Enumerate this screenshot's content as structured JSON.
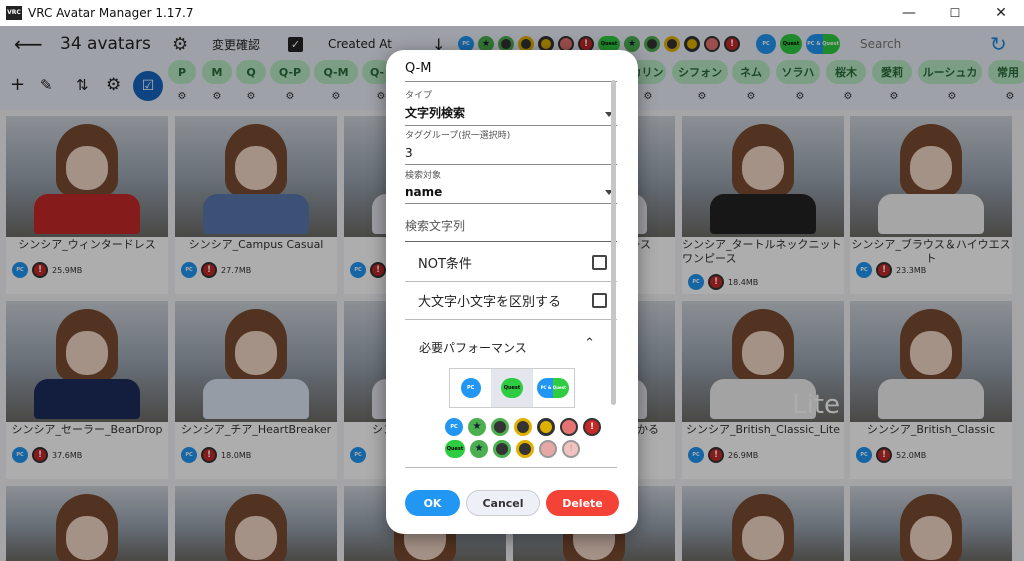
{
  "window": {
    "title": "VRC Avatar Manager 1.17.7",
    "minimize": "—",
    "maximize": "☐",
    "close": "✕"
  },
  "appbar": {
    "back_icon": "arrow-left-icon",
    "avatar_count": "34 avatars",
    "change_confirm": "変更確認",
    "sort_label": "Created At",
    "search_placeholder": "Search"
  },
  "chips": [
    "P",
    "M",
    "Q",
    "Q-P",
    "Q-M",
    "Q-",
    "カリン",
    "シフォン",
    "ネム",
    "ソラハ",
    "桜木",
    "愛莉",
    "ルーシュカ",
    "常用"
  ],
  "filter_badges": {
    "pc": "PC",
    "quest": "Quest",
    "pcq": "PC & Quest"
  },
  "cards": [
    {
      "name": "シンシア_ウィンタードレス",
      "size": "25.9MB"
    },
    {
      "name": "シンシア_Campus Casual",
      "size": "27.7MB"
    },
    {
      "name": "",
      "size": ""
    },
    {
      "name": "",
      "size": ""
    },
    {
      "name": "ース",
      "size": ""
    },
    {
      "name": "シンシア_タートルネックニットワンピース",
      "size": "18.4MB"
    },
    {
      "name": "シンシア_ブラウス＆ハイウエスト",
      "size": "23.3MB"
    },
    {
      "name": "シンシア_セーラー_BearDrop",
      "size": "37.6MB"
    },
    {
      "name": "シンシア_チア_HeartBreaker",
      "size": "18.0MB"
    },
    {
      "name": "シン",
      "size": ""
    },
    {
      "name": "",
      "size": ""
    },
    {
      "name": "じかる",
      "size": ""
    },
    {
      "name": "シンシア_British_Classic_Lite",
      "size": "26.9MB"
    },
    {
      "name": "シンシア_British_Classic",
      "size": "52.0MB"
    }
  ],
  "lite_overlay": "Lite",
  "dialog": {
    "name_value": "Q-M",
    "type_label": "タイプ",
    "type_value": "文字列検索",
    "tag_group_label": "タググループ(択一選択時)",
    "tag_group_value": "3",
    "search_target_label": "検索対象",
    "search_target_value": "name",
    "search_string_placeholder": "検索文字列",
    "not_condition": "NOT条件",
    "case_sensitive": "大文字小文字を区別する",
    "required_performance": "必要パフォーマンス",
    "platforms": [
      "PC",
      "Quest",
      "PC & Quest"
    ],
    "ok": "OK",
    "cancel": "Cancel",
    "delete": "Delete"
  },
  "colors": {
    "accent": "#2196f3",
    "delete": "#f44336",
    "chip_bg": "#b7e9c3",
    "chip_text": "#2b6a3a",
    "appbar_bg": "#e9edf7"
  }
}
